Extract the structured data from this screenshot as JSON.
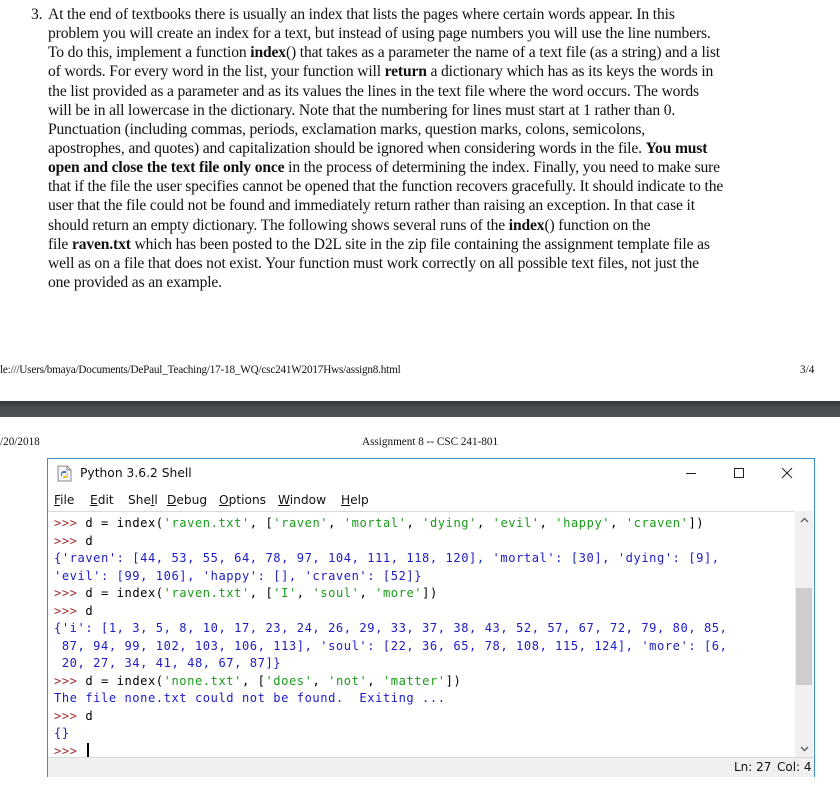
{
  "problem": {
    "number": "3.",
    "lines": [
      [
        {
          "t": "At the end of textbooks there is usually an index that lists the pages where certain words appear. In this"
        }
      ],
      [
        {
          "t": "problem you will create an index for a text, but instead of using page numbers you will use the line numbers."
        }
      ],
      [
        {
          "t": "To do this, implement a function "
        },
        {
          "t": "index",
          "b": true
        },
        {
          "t": "() that takes as a parameter the name of a text file (as a string) and a list"
        }
      ],
      [
        {
          "t": "of words. For every word in the list, your function will "
        },
        {
          "t": "return",
          "b": true
        },
        {
          "t": " a dictionary which has as its keys the words in"
        }
      ],
      [
        {
          "t": "the list provided as a parameter and as its values the lines in the text file where the word occurs. The words"
        }
      ],
      [
        {
          "t": "will be in all lowercase in the dictionary. Note that the numbering for lines must start at 1 rather than 0."
        }
      ],
      [
        {
          "t": "Punctuation (including commas, periods, exclamation marks, question marks, colons, semicolons,"
        }
      ],
      [
        {
          "t": "apostrophes, and quotes) and capitalization should be ignored when considering words in the file. "
        },
        {
          "t": "You must",
          "b": true
        }
      ],
      [
        {
          "t": "open and close the text file only once",
          "b": true
        },
        {
          "t": " in the process of determining the index. Finally, you need to make sure"
        }
      ],
      [
        {
          "t": "that if the file the user specifies cannot be opened that the function recovers gracefully. It should indicate to the"
        }
      ],
      [
        {
          "t": "user that the file could not be found and immediately return rather than raising an exception.  In that case it"
        }
      ],
      [
        {
          "t": "should return an empty dictionary. The following shows several runs of the "
        },
        {
          "t": "index",
          "b": true
        },
        {
          "t": "() function on the"
        }
      ],
      [
        {
          "t": "file "
        },
        {
          "t": "raven.txt",
          "b": true
        },
        {
          "t": " which has been posted to the D2L site in the zip file containing the assignment template file as"
        }
      ],
      [
        {
          "t": "well as on a file that does not exist.  Your function must work correctly on all possible text files, not just the"
        }
      ],
      [
        {
          "t": "one provided as an example."
        }
      ]
    ]
  },
  "page_footer": {
    "url": "le:///Users/bmaya/Documents/DePaul_Teaching/17-18_WQ/csc241W2017Hws/assign8.html",
    "page": "3/4"
  },
  "page_header": {
    "date": "/20/2018",
    "title": "Assignment 8 -- CSC 241-801"
  },
  "idle": {
    "title": "Python 3.6.2 Shell",
    "icon": "python-idle-icon",
    "window_buttons": {
      "minimize": "minimize-icon",
      "maximize": "maximize-icon",
      "close": "close-icon"
    },
    "menu": [
      {
        "pre": "",
        "u": "F",
        "post": "ile"
      },
      {
        "pre": "",
        "u": "E",
        "post": "dit"
      },
      {
        "pre": "She",
        "u": "l",
        "post": "l"
      },
      {
        "pre": "",
        "u": "D",
        "post": "ebug"
      },
      {
        "pre": "",
        "u": "O",
        "post": "ptions"
      },
      {
        "pre": "",
        "u": "W",
        "post": "indow"
      },
      {
        "pre": "",
        "u": "H",
        "post": "elp"
      }
    ],
    "shell_lines": [
      [
        {
          "c": "prompt",
          "t": ">>> "
        },
        {
          "c": "k",
          "t": "d = index("
        },
        {
          "c": "s",
          "t": "'raven.txt'"
        },
        {
          "c": "k",
          "t": ", ["
        },
        {
          "c": "s",
          "t": "'raven'"
        },
        {
          "c": "k",
          "t": ", "
        },
        {
          "c": "s",
          "t": "'mortal'"
        },
        {
          "c": "k",
          "t": ", "
        },
        {
          "c": "s",
          "t": "'dying'"
        },
        {
          "c": "k",
          "t": ", "
        },
        {
          "c": "s",
          "t": "'evil'"
        },
        {
          "c": "k",
          "t": ", "
        },
        {
          "c": "s",
          "t": "'happy'"
        },
        {
          "c": "k",
          "t": ", "
        },
        {
          "c": "s",
          "t": "'craven'"
        },
        {
          "c": "k",
          "t": "])"
        }
      ],
      [
        {
          "c": "prompt",
          "t": ">>> "
        },
        {
          "c": "k",
          "t": "d"
        }
      ],
      [
        {
          "c": "o",
          "t": "{'raven': [44, 53, 55, 64, 78, 97, 104, 111, 118, 120], 'mortal': [30], 'dying': [9],"
        }
      ],
      [
        {
          "c": "o",
          "t": "'evil': [99, 106], 'happy': [], 'craven': [52]}"
        }
      ],
      [
        {
          "c": "prompt",
          "t": ">>> "
        },
        {
          "c": "k",
          "t": "d = index("
        },
        {
          "c": "s",
          "t": "'raven.txt'"
        },
        {
          "c": "k",
          "t": ", ["
        },
        {
          "c": "s",
          "t": "'I'"
        },
        {
          "c": "k",
          "t": ", "
        },
        {
          "c": "s",
          "t": "'soul'"
        },
        {
          "c": "k",
          "t": ", "
        },
        {
          "c": "s",
          "t": "'more'"
        },
        {
          "c": "k",
          "t": "])"
        }
      ],
      [
        {
          "c": "prompt",
          "t": ">>> "
        },
        {
          "c": "k",
          "t": "d"
        }
      ],
      [
        {
          "c": "o",
          "t": "{'i': [1, 3, 5, 8, 10, 17, 23, 24, 26, 29, 33, 37, 38, 43, 52, 57, 67, 72, 79, 80, 85,"
        }
      ],
      [
        {
          "c": "o",
          "t": " 87, 94, 99, 102, 103, 106, 113], 'soul': [22, 36, 65, 78, 108, 115, 124], 'more': [6,"
        }
      ],
      [
        {
          "c": "o",
          "t": " 20, 27, 34, 41, 48, 67, 87]}"
        }
      ],
      [
        {
          "c": "prompt",
          "t": ">>> "
        },
        {
          "c": "k",
          "t": "d = index("
        },
        {
          "c": "s",
          "t": "'none.txt'"
        },
        {
          "c": "k",
          "t": ", ["
        },
        {
          "c": "s",
          "t": "'does'"
        },
        {
          "c": "k",
          "t": ", "
        },
        {
          "c": "s",
          "t": "'not'"
        },
        {
          "c": "k",
          "t": ", "
        },
        {
          "c": "s",
          "t": "'matter'"
        },
        {
          "c": "k",
          "t": "])"
        }
      ],
      [
        {
          "c": "o",
          "t": "The file none.txt could not be found.  Exiting ..."
        }
      ],
      [
        {
          "c": "prompt",
          "t": ">>> "
        },
        {
          "c": "k",
          "t": "d"
        }
      ],
      [
        {
          "c": "o",
          "t": "{}"
        }
      ],
      [
        {
          "c": "prompt",
          "t": ">>> "
        },
        {
          "c": "cursor",
          "t": ""
        }
      ]
    ],
    "scroll_position": 0.52,
    "status": {
      "ln": "Ln: 27",
      "col": "Col: 4"
    }
  },
  "colors": {
    "prompt": "#a52a2a",
    "code": "#000000",
    "string": "#1b9b1b",
    "output": "#1d1dc6",
    "window_border": "#3c8fd2"
  }
}
